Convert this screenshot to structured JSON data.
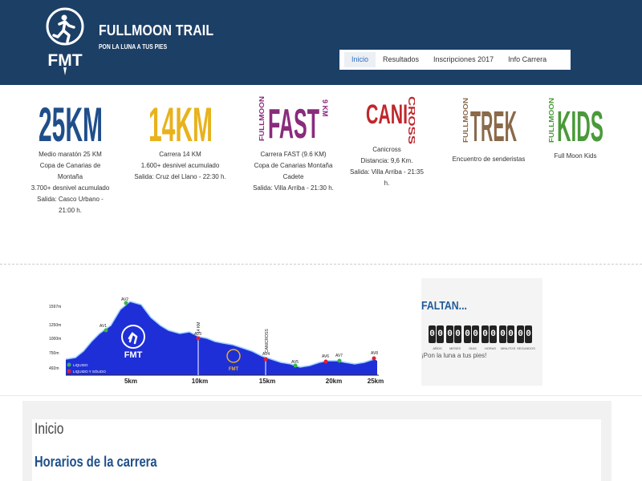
{
  "header": {
    "logo_text": "FMT",
    "title": "FULLMOON TRAIL",
    "tagline": "PON LA LUNA A TUS PIES",
    "colors": {
      "background": "#1c3f66"
    }
  },
  "nav": {
    "items": [
      {
        "label": "Inicio",
        "active": true
      },
      {
        "label": "Resultados"
      },
      {
        "label": "Inscripciones 2017"
      },
      {
        "label": "Info Carrera"
      }
    ]
  },
  "races": [
    {
      "logo": "25KM",
      "logo_color": "#1f4e8a",
      "lines": [
        "Medio maratón 25 KM",
        "Copa de Canarias de",
        "Montaña",
        "3.700+ desnivel acumulado",
        "Salida: Casco Urbano -",
        "21:00 h."
      ]
    },
    {
      "logo": "14KM",
      "logo_color": "#e8b21c",
      "lines": [
        "Carrera 14 KM",
        "1.600+ desnivel acumulado",
        "Salida: Cruz del Llano - 22:30 h."
      ]
    },
    {
      "logo": "FAST",
      "logo_prefix": "FULLMOON",
      "logo_suffix": "9 KM",
      "logo_color": "#8a2b7c",
      "lines": [
        "Carrera FAST (9.6 KM)",
        "Copa de Canarias Montaña",
        "Cadete",
        "Salida: Villa Arriba - 21:30 h."
      ]
    },
    {
      "logo": "CANI CROSS",
      "logo_color": "#c0272d",
      "lines": [
        "Canicross",
        "Distancia: 9,6 Km.",
        "Salida: Villa Arriba - 21:35",
        "h."
      ]
    },
    {
      "logo": "TREK",
      "logo_prefix": "FULLMOON",
      "logo_color": "#8a6a4a",
      "lines": [
        "Encuentro de senderistas"
      ]
    },
    {
      "logo": "KIDS",
      "logo_prefix": "FULLMOON",
      "logo_color": "#4a9a3a",
      "lines": [
        "Full Moon Kids"
      ]
    }
  ],
  "profile": {
    "elevation_labels": [
      "1597m",
      "1250m",
      "1000m",
      "750m",
      "492m"
    ],
    "km_labels": [
      "5km",
      "10km",
      "15km",
      "20km",
      "25km"
    ],
    "markers": [
      "AV1",
      "AV2",
      "AV3",
      "AV4",
      "AV5",
      "AV6",
      "AV7",
      "AV8"
    ],
    "vertical_labels": [
      "14 KM",
      "CANICROSS"
    ],
    "badge_text": "FMT",
    "legend": [
      "LIQUIDO",
      "LIQUIDO Y SÓLIDO"
    ]
  },
  "countdown": {
    "title": "FALTAN...",
    "digits": [
      "0",
      "0",
      "0",
      "0",
      "0",
      "0",
      "0",
      "0",
      "0",
      "0",
      "0",
      "0"
    ],
    "labels": [
      "AÑOS",
      "MESES",
      "DÍAS",
      "HORAS",
      "MINUTOS",
      "SEGUNDOS"
    ],
    "message": "¡Pon la luna a tus pies!"
  },
  "content": {
    "page_title": "Inicio",
    "section_title": "Horarios de la carrera"
  }
}
